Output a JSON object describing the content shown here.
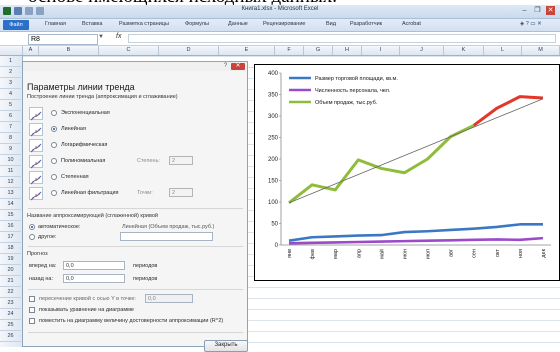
{
  "header_text": "основе имеющихся исходных данных.",
  "window": {
    "title": "Книга1.xlsx - Microsoft Excel",
    "minimize": "–",
    "restore": "❐",
    "close": "✕"
  },
  "ribbon": {
    "file_tab": "Файл",
    "tabs": [
      "Главная",
      "Вставка",
      "Разметка страницы",
      "Формулы",
      "Данные",
      "Рецензирование",
      "Вид",
      "Разработчик",
      "Acrobat"
    ]
  },
  "formula_bar": {
    "name_box": "R8",
    "fx": "fx",
    "value": ""
  },
  "columns": [
    "A",
    "B",
    "C",
    "D",
    "E",
    "F",
    "G",
    "H",
    "I",
    "J",
    "K",
    "L",
    "M"
  ],
  "rows": [
    "1",
    "2",
    "3",
    "4",
    "5",
    "6",
    "7",
    "8",
    "9",
    "10",
    "11",
    "12",
    "13",
    "14",
    "15",
    "16",
    "17",
    "18",
    "19",
    "20",
    "21",
    "22",
    "23",
    "24",
    "25",
    "26"
  ],
  "dialog": {
    "title": "Параметры линии тренда",
    "section_type": "Построение линии тренда (аппроксимация и сглаживание)",
    "options": [
      {
        "label": "Экспоненциальная",
        "selected": false,
        "sub_label": "",
        "sub_value": ""
      },
      {
        "label": "Линейная",
        "selected": true,
        "sub_label": "",
        "sub_value": ""
      },
      {
        "label": "Логарифмическая",
        "selected": false,
        "sub_label": "",
        "sub_value": ""
      },
      {
        "label": "Полиномиальная",
        "selected": false,
        "sub_label": "Степень:",
        "sub_value": "2"
      },
      {
        "label": "Степенная",
        "selected": false,
        "sub_label": "",
        "sub_value": ""
      },
      {
        "label": "Линейная фильтрация",
        "selected": false,
        "sub_label": "Точки:",
        "sub_value": "2"
      }
    ],
    "name_section": "Название аппроксимирующей (сглаженной) кривой",
    "name_auto_label": "автоматическое:",
    "name_auto_value": "Линейная (Объем продаж, тыс.руб.)",
    "name_other_label": "другое:",
    "forecast_section": "Прогноз",
    "forward_label": "вперед на:",
    "forward_value": "0,0",
    "backward_label": "назад на:",
    "backward_value": "0,0",
    "periods_label": "периодов",
    "intercept_label": "пересечение кривой с осью Y в точке:",
    "intercept_value": "0,0",
    "show_equation_label": "показывать уравнение на диаграмме",
    "show_r2_label": "поместить на диаграмму величину достоверности аппроксимации (R^2)",
    "close_button": "Закрыть"
  },
  "chart_data": {
    "type": "line",
    "categories": [
      "янв",
      "фев",
      "мар",
      "апр",
      "май",
      "июн",
      "июл",
      "авг",
      "сен",
      "окт",
      "ноя",
      "дек"
    ],
    "ylim": [
      0,
      400
    ],
    "yticks": [
      0,
      50,
      100,
      150,
      200,
      250,
      300,
      350,
      400
    ],
    "series": [
      {
        "name": "Размер торговой площади, кв.м.",
        "color": "#3b78c4",
        "values": [
          10,
          18,
          20,
          22,
          23,
          30,
          32,
          35,
          38,
          42,
          48,
          48
        ]
      },
      {
        "name": "Численность персонала, чел.",
        "color": "#9b4bc9",
        "values": [
          4,
          5,
          6,
          7,
          8,
          9,
          10,
          11,
          12,
          13,
          12,
          16
        ]
      },
      {
        "name": "Объем продаж, тыс.руб.",
        "color": "#8fbd3a",
        "values": [
          98,
          140,
          128,
          198,
          178,
          168,
          200,
          252,
          278,
          318,
          345,
          342
        ]
      }
    ],
    "forecast_color": "#e2372a",
    "trendline": {
      "from": 98,
      "to": 340,
      "color": "#666666"
    },
    "legend": "top-left-inside"
  }
}
